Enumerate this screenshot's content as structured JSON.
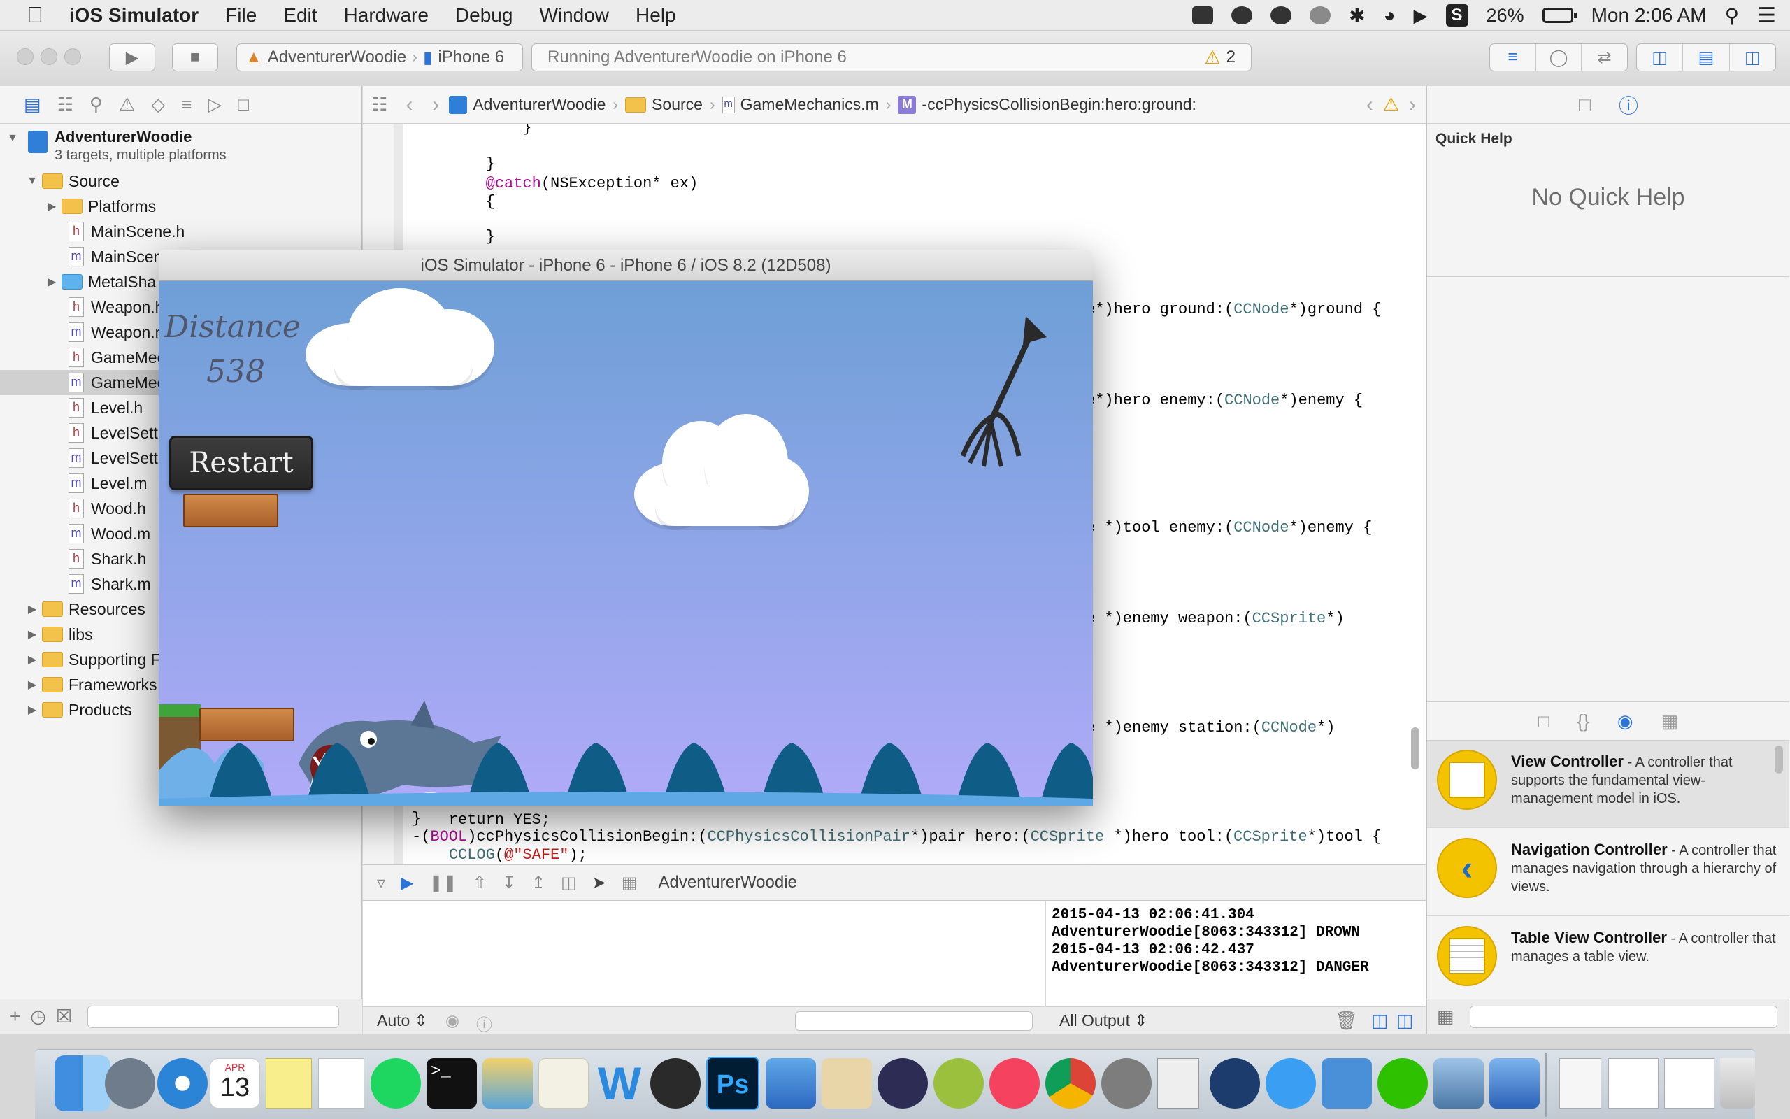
{
  "menubar": {
    "app_name": "iOS Simulator",
    "menus": [
      "File",
      "Edit",
      "Hardware",
      "Debug",
      "Window",
      "Help"
    ],
    "battery": "26%",
    "clock": "Mon 2:06 AM",
    "extra_icon": "S"
  },
  "toolbar": {
    "scheme_project": "AdventurerWoodie",
    "scheme_device": "iPhone 6",
    "activity_text": "Running AdventurerWoodie on iPhone 6",
    "warning_count": "2"
  },
  "navigator": {
    "project_name": "AdventurerWoodie",
    "project_subtitle": "3 targets, multiple platforms",
    "items": [
      {
        "label": "Source",
        "type": "folder"
      },
      {
        "label": "Platforms",
        "type": "folder"
      },
      {
        "label": "MainScene.h",
        "type": "h"
      },
      {
        "label": "MainScen",
        "type": "m"
      },
      {
        "label": "MetalSha",
        "type": "folder-blue"
      },
      {
        "label": "Weapon.h",
        "type": "h"
      },
      {
        "label": "Weapon.n",
        "type": "m"
      },
      {
        "label": "GameMec",
        "type": "h"
      },
      {
        "label": "GameMec",
        "type": "m"
      },
      {
        "label": "Level.h",
        "type": "h"
      },
      {
        "label": "LevelSett",
        "type": "h"
      },
      {
        "label": "LevelSett",
        "type": "m"
      },
      {
        "label": "Level.m",
        "type": "m"
      },
      {
        "label": "Wood.h",
        "type": "h"
      },
      {
        "label": "Wood.m",
        "type": "m"
      },
      {
        "label": "Shark.h",
        "type": "h"
      },
      {
        "label": "Shark.m",
        "type": "m"
      },
      {
        "label": "Resources",
        "type": "folder"
      },
      {
        "label": "libs",
        "type": "folder"
      },
      {
        "label": "Supporting F",
        "type": "folder"
      },
      {
        "label": "Frameworks",
        "type": "folder"
      },
      {
        "label": "Products",
        "type": "folder"
      }
    ]
  },
  "jumpbar": {
    "project": "AdventurerWoodie",
    "group": "Source",
    "file": "GameMechanics.m",
    "method": "-ccPhysicsCollisionBegin:hero:ground:"
  },
  "code": {
    "lines": [
      "            }",
      "        }",
      "        @catch(NSException* ex)",
      "        {",
      "        }",
      "e*)hero ground:(CCNode*)ground {",
      "e*)hero enemy:(CCNode*)enemy {",
      "e *)tool enemy:(CCNode*)enemy {",
      "e *)enemy weapon:(CCSprite*)",
      "e *)enemy station:(CCNode*)",
      "    return YES;",
      "}",
      "-(BOOL)ccPhysicsCollisionBegin:(CCPhysicsCollisionPair*)pair hero:(CCSprite *)hero tool:(CCSprite*)tool {",
      "    CCLOG(@\"SAFE\");"
    ]
  },
  "debug": {
    "target": "AdventurerWoodie",
    "auto_label": "Auto",
    "output_label": "All Output",
    "console_lines": [
      "2015-04-13 02:06:41.304",
      "AdventurerWoodie[8063:343312] DROWN",
      "2015-04-13 02:06:42.437",
      "AdventurerWoodie[8063:343312] DANGER"
    ]
  },
  "utilities": {
    "quick_help_title": "Quick Help",
    "quick_help_empty": "No Quick Help",
    "library": [
      {
        "name": "View Controller",
        "desc": " - A controller that supports the fundamental view-management model in iOS."
      },
      {
        "name": "Navigation Controller",
        "desc": " - A controller that manages navigation through a hierarchy of views."
      },
      {
        "name": "Table View Controller",
        "desc": " - A controller that manages a table view."
      }
    ]
  },
  "simulator": {
    "title": "iOS Simulator - iPhone 6 - iPhone 6 / iOS 8.2 (12D508)",
    "hud_distance_label": "Distance",
    "hud_distance_value": "538",
    "restart_label": "Restart"
  },
  "dock": {
    "calendar_month": "APR",
    "calendar_day": "13",
    "ps_label": "Ps",
    "w_label": "W"
  }
}
